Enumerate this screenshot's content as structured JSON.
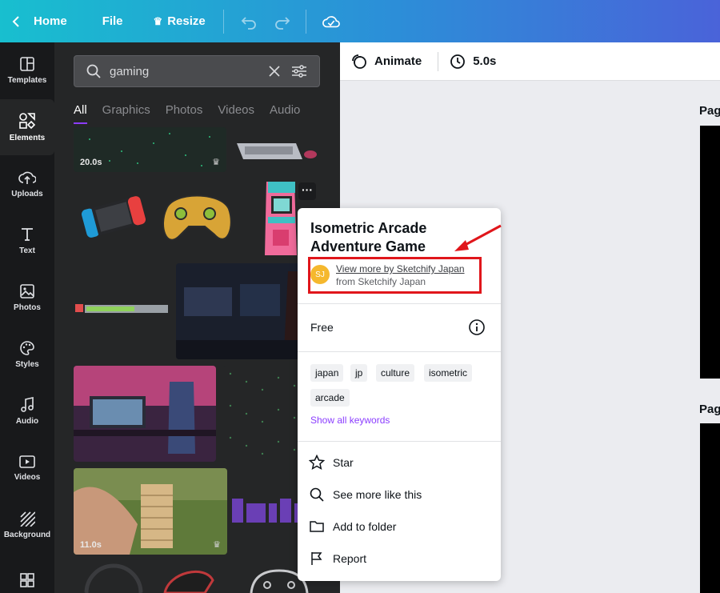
{
  "topbar": {
    "home_label": "Home",
    "file_label": "File",
    "resize_label": "Resize",
    "icons": [
      "chevron-left-icon",
      "crown-icon",
      "undo-icon",
      "redo-icon",
      "cloud-check-icon"
    ]
  },
  "rail": {
    "items": [
      {
        "label": "Templates",
        "icon": "templates-icon"
      },
      {
        "label": "Elements",
        "icon": "elements-icon"
      },
      {
        "label": "Uploads",
        "icon": "cloud-upload-icon"
      },
      {
        "label": "Text",
        "icon": "text-icon"
      },
      {
        "label": "Photos",
        "icon": "photo-icon"
      },
      {
        "label": "Styles",
        "icon": "palette-icon"
      },
      {
        "label": "Audio",
        "icon": "music-note-icon"
      },
      {
        "label": "Videos",
        "icon": "video-icon"
      },
      {
        "label": "Background",
        "icon": "stripes-icon"
      },
      {
        "label": "",
        "icon": "grid-icon"
      }
    ],
    "active": "Elements"
  },
  "search": {
    "value": "gaming"
  },
  "tabs": [
    "All",
    "Graphics",
    "Photos",
    "Videos",
    "Audio"
  ],
  "results": {
    "durations": [
      "20.0s",
      "11.0s"
    ]
  },
  "canvas_toolbar": {
    "animate_label": "Animate",
    "duration_label": "5.0s"
  },
  "pages": {
    "label_1": "Pag",
    "label_2": "Pag"
  },
  "popup": {
    "title": "Isometric Arcade Adventure Game",
    "avatar_initials": "SJ",
    "author_link": "View more by Sketchify Japan",
    "author_from": "from Sketchify Japan",
    "price": "Free",
    "keywords": [
      "japan",
      "jp",
      "culture",
      "isometric",
      "arcade"
    ],
    "show_keywords": "Show all keywords",
    "menu": [
      {
        "label": "Star",
        "icon": "star-icon"
      },
      {
        "label": "See more like this",
        "icon": "search-icon"
      },
      {
        "label": "Add to folder",
        "icon": "folder-icon"
      },
      {
        "label": "Report",
        "icon": "flag-icon"
      }
    ]
  },
  "colors": {
    "accent": "#8b3dff",
    "annotation": "#e0161b",
    "avatar": "#f5b82e"
  }
}
